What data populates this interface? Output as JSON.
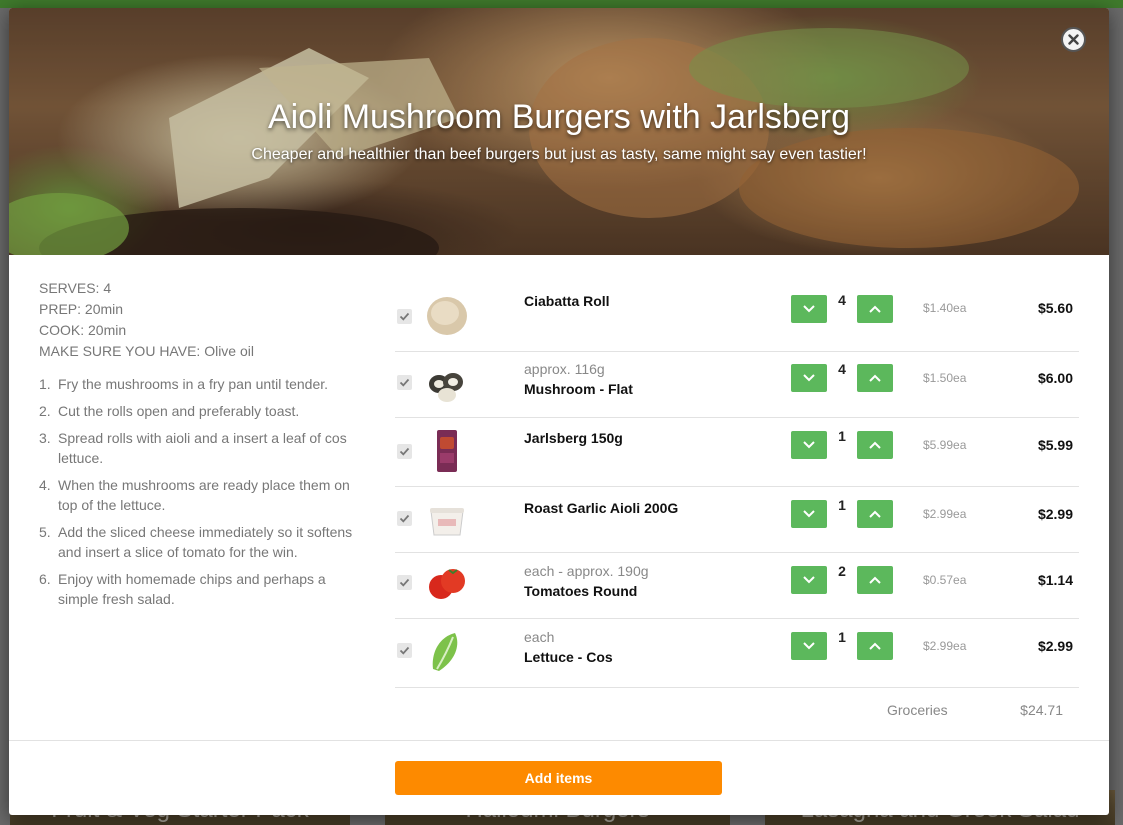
{
  "recipe": {
    "title": "Aioli Mushroom Burgers with Jarlsberg",
    "subtitle": "Cheaper and healthier than beef burgers but just as tasty, same might say even tastier!",
    "serves": "SERVES: 4",
    "prep": "PREP: 20min",
    "cook": "COOK: 20min",
    "have": "MAKE SURE YOU HAVE: Olive oil",
    "steps": [
      {
        "num": "1.",
        "text": "Fry the mushrooms in a fry pan until tender."
      },
      {
        "num": "2.",
        "text": "Cut the rolls open and preferably toast."
      },
      {
        "num": "3.",
        "text": "Spread rolls with aioli and a insert a leaf of cos lettuce."
      },
      {
        "num": "4.",
        "text": "When the mushrooms are ready place them on top of the lettuce."
      },
      {
        "num": "5.",
        "text": "Add the sliced cheese immediately so it softens and insert a slice of tomato for the win."
      },
      {
        "num": "6.",
        "text": "Enjoy with homemade chips and perhaps a simple fresh salad."
      }
    ]
  },
  "products": [
    {
      "sub": "",
      "name": "Ciabatta Roll",
      "qty": "4",
      "unit": "$1.40ea",
      "total": "$5.60",
      "icon": "bread-roll-icon"
    },
    {
      "sub": "approx. 116g",
      "name": "Mushroom - Flat",
      "qty": "4",
      "unit": "$1.50ea",
      "total": "$6.00",
      "icon": "mushroom-icon"
    },
    {
      "sub": "",
      "name": "Jarlsberg 150g",
      "qty": "1",
      "unit": "$5.99ea",
      "total": "$5.99",
      "icon": "cheese-pack-icon"
    },
    {
      "sub": "",
      "name": "Roast Garlic Aioli 200G",
      "qty": "1",
      "unit": "$2.99ea",
      "total": "$2.99",
      "icon": "aioli-tub-icon"
    },
    {
      "sub": "each - approx. 190g",
      "name": "Tomatoes Round",
      "qty": "2",
      "unit": "$0.57ea",
      "total": "$1.14",
      "icon": "tomato-icon"
    },
    {
      "sub": "each",
      "name": "Lettuce - Cos",
      "qty": "1",
      "unit": "$2.99ea",
      "total": "$2.99",
      "icon": "lettuce-icon"
    }
  ],
  "summary": {
    "label": "Groceries",
    "value": "$24.71"
  },
  "actions": {
    "add_items": "Add items"
  },
  "background_cards": [
    "Fruit & Veg Starter Pack",
    "Halloumi Burgers",
    "Lasagna and Greek Salad"
  ],
  "colors": {
    "accent_green": "#5cb85c",
    "add_button": "#fd8a00",
    "top_bar": "#3f7a2c"
  }
}
